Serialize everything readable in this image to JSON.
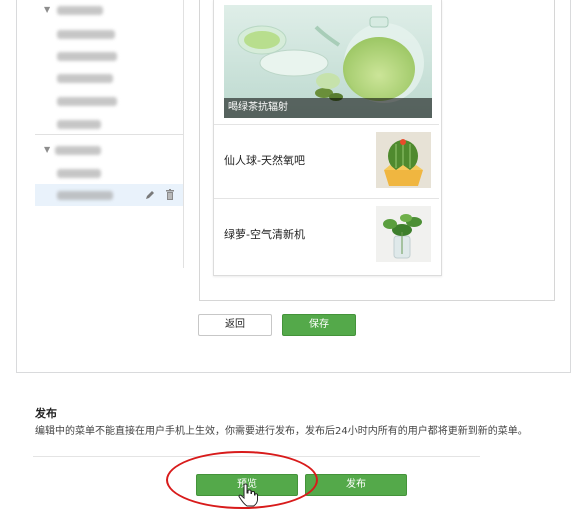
{
  "editor": {
    "back_button": "返回",
    "save_button": "保存"
  },
  "menu_tree": {
    "group1_children": 5,
    "group2_children": 2
  },
  "preview": {
    "hero_caption": "喝绿茶抗辐射",
    "articles": [
      {
        "title": "仙人球-天然氧吧",
        "thumb": "cactus-image"
      },
      {
        "title": "绿萝-空气清新机",
        "thumb": "pothos-image"
      }
    ]
  },
  "publish": {
    "title": "发布",
    "description": "编辑中的菜单不能直接在用户手机上生效，你需要进行发布，发布后24小时内所有的用户都将更新到新的菜单。",
    "preview_button": "预览",
    "publish_button": "发布"
  },
  "colors": {
    "green_button": "#54a94a",
    "highlight_circle": "#d81b1b",
    "selected_row": "#e9f2fb"
  }
}
